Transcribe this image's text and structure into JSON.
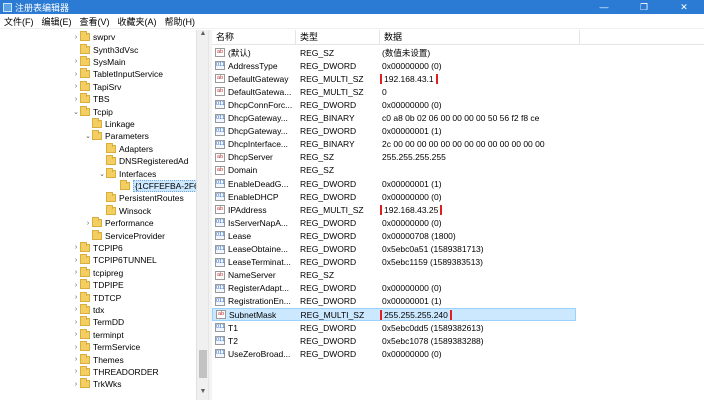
{
  "window": {
    "title": "注册表编辑器",
    "minimize": "—",
    "restore": "❐",
    "close": "✕"
  },
  "menu": [
    "文件(F)",
    "编辑(E)",
    "查看(V)",
    "收藏夹(A)",
    "帮助(H)"
  ],
  "tree": [
    {
      "label": "swprv",
      "depth": 0,
      "arrow": "›"
    },
    {
      "label": "Synth3dVsc",
      "depth": 0,
      "arrow": ""
    },
    {
      "label": "SysMain",
      "depth": 0,
      "arrow": "›"
    },
    {
      "label": "TabletInputService",
      "depth": 0,
      "arrow": "›"
    },
    {
      "label": "TapiSrv",
      "depth": 0,
      "arrow": "›"
    },
    {
      "label": "TBS",
      "depth": 0,
      "arrow": "›"
    },
    {
      "label": "Tcpip",
      "depth": 0,
      "arrow": "⌄"
    },
    {
      "label": "Linkage",
      "depth": 1,
      "arrow": ""
    },
    {
      "label": "Parameters",
      "depth": 1,
      "arrow": "⌄"
    },
    {
      "label": "Adapters",
      "depth": 2,
      "arrow": ""
    },
    {
      "label": "DNSRegisteredAd",
      "depth": 2,
      "arrow": ""
    },
    {
      "label": "Interfaces",
      "depth": 2,
      "arrow": "⌄"
    },
    {
      "label": "{1CFFEFBA-2F6",
      "depth": 3,
      "arrow": "",
      "selected": true
    },
    {
      "label": "PersistentRoutes",
      "depth": 2,
      "arrow": ""
    },
    {
      "label": "Winsock",
      "depth": 2,
      "arrow": ""
    },
    {
      "label": "Performance",
      "depth": 1,
      "arrow": "›"
    },
    {
      "label": "ServiceProvider",
      "depth": 1,
      "arrow": ""
    },
    {
      "label": "TCPIP6",
      "depth": 0,
      "arrow": "›"
    },
    {
      "label": "TCPIP6TUNNEL",
      "depth": 0,
      "arrow": "›"
    },
    {
      "label": "tcpipreg",
      "depth": 0,
      "arrow": "›"
    },
    {
      "label": "TDPIPE",
      "depth": 0,
      "arrow": "›"
    },
    {
      "label": "TDTCP",
      "depth": 0,
      "arrow": "›"
    },
    {
      "label": "tdx",
      "depth": 0,
      "arrow": "›"
    },
    {
      "label": "TermDD",
      "depth": 0,
      "arrow": "›"
    },
    {
      "label": "terminpt",
      "depth": 0,
      "arrow": "›"
    },
    {
      "label": "TermService",
      "depth": 0,
      "arrow": "›"
    },
    {
      "label": "Themes",
      "depth": 0,
      "arrow": "›"
    },
    {
      "label": "THREADORDER",
      "depth": 0,
      "arrow": "›"
    },
    {
      "label": "TrkWks",
      "depth": 0,
      "arrow": "›"
    }
  ],
  "columns": {
    "name": "名称",
    "type": "类型",
    "data": "数据"
  },
  "values": [
    {
      "name": "(默认)",
      "type": "REG_SZ",
      "data": "(数值未设置)",
      "icon": "ab"
    },
    {
      "name": "AddressType",
      "type": "REG_DWORD",
      "data": "0x00000000 (0)",
      "icon": "011"
    },
    {
      "name": "DefaultGateway",
      "type": "REG_MULTI_SZ",
      "data": "192.168.43.1",
      "icon": "ab",
      "highlight": true
    },
    {
      "name": "DefaultGatewa...",
      "type": "REG_MULTI_SZ",
      "data": "0",
      "icon": "ab"
    },
    {
      "name": "DhcpConnForc...",
      "type": "REG_DWORD",
      "data": "0x00000000 (0)",
      "icon": "011"
    },
    {
      "name": "DhcpGateway...",
      "type": "REG_BINARY",
      "data": "c0 a8 0b 02 06 00 00 00 00 50 56 f2 f8 ce",
      "icon": "011"
    },
    {
      "name": "DhcpGateway...",
      "type": "REG_DWORD",
      "data": "0x00000001 (1)",
      "icon": "011"
    },
    {
      "name": "DhcpInterface...",
      "type": "REG_BINARY",
      "data": "2c 00 00 00 00 00 00 00 00 00 00 00 00 00",
      "icon": "011"
    },
    {
      "name": "DhcpServer",
      "type": "REG_SZ",
      "data": "255.255.255.255",
      "icon": "ab"
    },
    {
      "name": "Domain",
      "type": "REG_SZ",
      "data": "",
      "icon": "ab"
    },
    {
      "name": "EnableDeadG...",
      "type": "REG_DWORD",
      "data": "0x00000001 (1)",
      "icon": "011"
    },
    {
      "name": "EnableDHCP",
      "type": "REG_DWORD",
      "data": "0x00000000 (0)",
      "icon": "011"
    },
    {
      "name": "IPAddress",
      "type": "REG_MULTI_SZ",
      "data": "192.168.43.25",
      "icon": "ab",
      "highlight": true
    },
    {
      "name": "IsServerNapA...",
      "type": "REG_DWORD",
      "data": "0x00000000 (0)",
      "icon": "011"
    },
    {
      "name": "Lease",
      "type": "REG_DWORD",
      "data": "0x00000708 (1800)",
      "icon": "011"
    },
    {
      "name": "LeaseObtaine...",
      "type": "REG_DWORD",
      "data": "0x5ebc0a51 (1589381713)",
      "icon": "011"
    },
    {
      "name": "LeaseTerminat...",
      "type": "REG_DWORD",
      "data": "0x5ebc1159 (1589383513)",
      "icon": "011"
    },
    {
      "name": "NameServer",
      "type": "REG_SZ",
      "data": "",
      "icon": "ab"
    },
    {
      "name": "RegisterAdapt...",
      "type": "REG_DWORD",
      "data": "0x00000000 (0)",
      "icon": "011"
    },
    {
      "name": "RegistrationEn...",
      "type": "REG_DWORD",
      "data": "0x00000001 (1)",
      "icon": "011"
    },
    {
      "name": "SubnetMask",
      "type": "REG_MULTI_SZ",
      "data": "255.255.255.240",
      "icon": "ab",
      "highlight": true,
      "selected": true
    },
    {
      "name": "T1",
      "type": "REG_DWORD",
      "data": "0x5ebc0dd5 (1589382613)",
      "icon": "011"
    },
    {
      "name": "T2",
      "type": "REG_DWORD",
      "data": "0x5ebc1078 (1589383288)",
      "icon": "011"
    },
    {
      "name": "UseZeroBroad...",
      "type": "REG_DWORD",
      "data": "0x00000000 (0)",
      "icon": "011"
    }
  ],
  "colors": {
    "titlebar": "#2b7bd4",
    "selection": "#cce8ff",
    "highlight_box": "#e02020"
  }
}
